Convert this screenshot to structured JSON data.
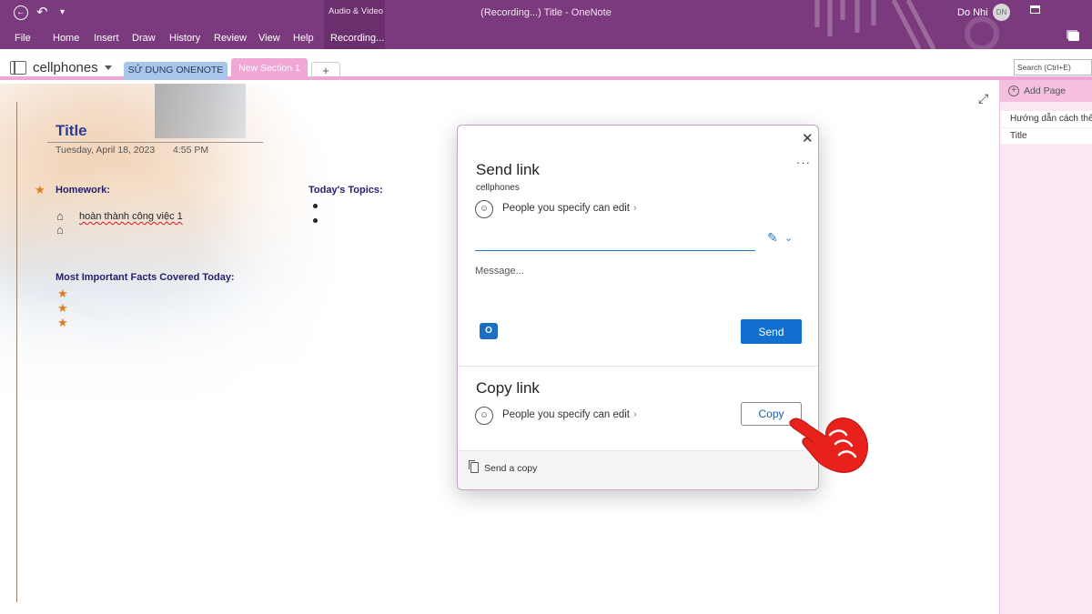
{
  "titlebar": {
    "context_group": "Audio & Video",
    "window_title": "(Recording...) Title  -  OneNote",
    "user_name": "Do Nhi",
    "user_initials": "DN"
  },
  "menu": [
    "File",
    "Home",
    "Insert",
    "Draw",
    "History",
    "Review",
    "View",
    "Help",
    "Recording..."
  ],
  "notebook": {
    "name": "cellphones",
    "sections": [
      "SỬ DỤNG ONENOTE",
      "New Section 1"
    ],
    "add_section": "+",
    "search_placeholder": "Search (Ctrl+E)"
  },
  "page": {
    "title": "Title",
    "date": "Tuesday, April 18, 2023",
    "time": "4:55 PM",
    "homework_heading": "Homework:",
    "homework_task": "hoàn thành công việc 1",
    "topics_heading": "Today's Topics:",
    "facts_heading": "Most Important Facts Covered Today:"
  },
  "page_panel": {
    "add_page": "Add Page",
    "pages": [
      "Hướng dẫn cách thêm",
      "Title"
    ]
  },
  "dialog": {
    "send_heading": "Send link",
    "notebook_name": "cellphones",
    "permission": "People you specify can edit",
    "message_placeholder": "Message...",
    "send_label": "Send",
    "copy_heading": "Copy link",
    "copy_label": "Copy",
    "send_copy": "Send a copy"
  },
  "colors": {
    "ribbon": "#7b3a7d",
    "accent_pink": "#f0a6d7",
    "primary_blue": "#1170cf",
    "pointer_red": "#e8211c"
  }
}
